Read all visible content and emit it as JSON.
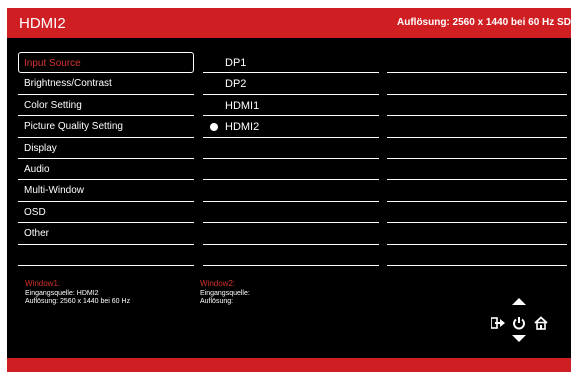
{
  "header": {
    "title": "HDMI2",
    "resolution": "Auflösung: 2560 x 1440 bei 60 Hz SD"
  },
  "menu": {
    "items": [
      {
        "label": "Input Source",
        "selected": true
      },
      {
        "label": "Brightness/Contrast"
      },
      {
        "label": "Color Setting"
      },
      {
        "label": "Picture Quality Setting"
      },
      {
        "label": "Display"
      },
      {
        "label": "Audio"
      },
      {
        "label": "Multi-Window"
      },
      {
        "label": "OSD"
      },
      {
        "label": "Other"
      },
      {
        "label": ""
      }
    ]
  },
  "options": {
    "items": [
      {
        "label": "DP1"
      },
      {
        "label": "DP2"
      },
      {
        "label": "HDMI1"
      },
      {
        "label": "HDMI2",
        "selected": true
      },
      {
        "label": ""
      },
      {
        "label": ""
      },
      {
        "label": ""
      },
      {
        "label": ""
      },
      {
        "label": ""
      },
      {
        "label": ""
      }
    ]
  },
  "window1": {
    "title": "Window1:",
    "source": "Eingangsquelle: HDMI2",
    "resolution": "Auflösung: 2560 x 1440 bei 60 Hz"
  },
  "window2": {
    "title": "Window2:",
    "source": "Eingangsquelle:",
    "resolution": "Auflösung:"
  },
  "icons": {
    "up": "arrow-up-icon",
    "down": "arrow-down-icon",
    "exit": "exit-icon",
    "power": "power-icon",
    "home": "home-icon"
  },
  "colors": {
    "accent": "#cf1f23",
    "selected_text": "#d5322d",
    "background": "#000000"
  }
}
